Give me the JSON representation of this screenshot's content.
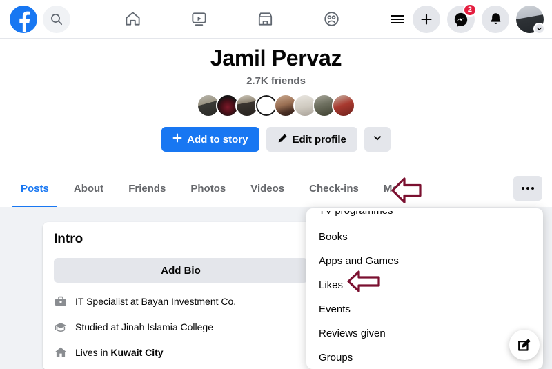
{
  "topbar": {
    "logo_name": "facebook-logo",
    "search_placeholder": "Search Facebook",
    "nav_items": [
      {
        "name": "home-icon",
        "label": "Home"
      },
      {
        "name": "video-icon",
        "label": "Video"
      },
      {
        "name": "marketplace-icon",
        "label": "Marketplace"
      },
      {
        "name": "groups-icon",
        "label": "Groups"
      }
    ],
    "menu_label": "Menu",
    "create_label": "Create",
    "messenger_label": "Messenger",
    "messenger_badge": "2",
    "notifications_label": "Notifications",
    "account_label": "Account"
  },
  "profile": {
    "name": "Jamil Pervaz",
    "friends_count": "2.7K friends",
    "friend_avatars": [
      "friend-avatar-1",
      "friend-avatar-2",
      "friend-avatar-3",
      "friend-avatar-4",
      "friend-avatar-5",
      "friend-avatar-6",
      "friend-avatar-7",
      "friend-avatar-8"
    ],
    "add_story_label": "Add to story",
    "edit_profile_label": "Edit profile",
    "more_options_label": ""
  },
  "tabs": [
    {
      "label": "Posts",
      "active": true
    },
    {
      "label": "About",
      "active": false
    },
    {
      "label": "Friends",
      "active": false
    },
    {
      "label": "Photos",
      "active": false
    },
    {
      "label": "Videos",
      "active": false
    },
    {
      "label": "Check-ins",
      "active": false
    },
    {
      "label": "More",
      "active": false
    }
  ],
  "dropdown": {
    "items": [
      "TV programmes",
      "Books",
      "Apps and Games",
      "Likes",
      "Events",
      "Reviews given",
      "Groups"
    ]
  },
  "intro": {
    "title": "Intro",
    "add_bio_label": "Add Bio",
    "items": [
      {
        "icon": "briefcase-icon",
        "text": "IT Specialist at Bayan Investment Co.",
        "bold": ""
      },
      {
        "icon": "graduation-cap-icon",
        "text": "Studied at Jinah Islamia College",
        "bold": ""
      },
      {
        "icon": "home-icon",
        "text": "Lives in ",
        "bold": "Kuwait City"
      }
    ]
  },
  "fab": {
    "label": "Create post"
  },
  "colors": {
    "brand_blue": "#1877F2",
    "badge_red": "#E41E3F",
    "annotation_maroon": "#7B1030",
    "page_bg": "#F0F2F5",
    "secondary_text": "#65676B"
  },
  "annotations": [
    {
      "name": "arrow-pointing-more-tab",
      "direction": "left"
    },
    {
      "name": "arrow-pointing-likes-item",
      "direction": "left"
    }
  ]
}
